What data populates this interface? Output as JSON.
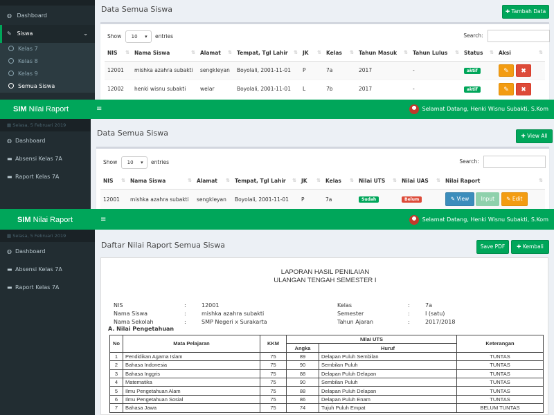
{
  "screen1": {
    "sidebar": {
      "items": [
        {
          "icon": "dashboard-icon",
          "label": "Dashboard"
        },
        {
          "icon": "edit-icon",
          "label": "Siswa"
        }
      ],
      "subitems": [
        "Kelas 7",
        "Kelas 8",
        "Kelas 9",
        "Semua Siswa"
      ]
    },
    "page_title": "Data Semua Siswa",
    "add_button": "Tambah Data",
    "show_label": "Show",
    "entries_value": "10",
    "entries_label": "entries",
    "search_label": "Search:",
    "columns": [
      "NIS",
      "Nama Siswa",
      "Alamat",
      "Tempat, Tgl Lahir",
      "JK",
      "Kelas",
      "Tahun Masuk",
      "Tahun Lulus",
      "Status",
      "Aksi"
    ],
    "rows": [
      {
        "nis": "12001",
        "nama": "mishka azahra subakti",
        "alamat": "sengkleyan",
        "ttl": "Boyolali, 2001-11-01",
        "jk": "P",
        "kelas": "7a",
        "masuk": "2017",
        "lulus": "-",
        "status": "aktif"
      },
      {
        "nis": "12002",
        "nama": "henki wisnu subakti",
        "alamat": "welar",
        "ttl": "Boyolali, 2001-11-01",
        "jk": "L",
        "kelas": "7b",
        "masuk": "2017",
        "lulus": "-",
        "status": "aktif"
      }
    ]
  },
  "screen2": {
    "brand_bold": "SIM",
    "brand_rest": " Nilai Raport",
    "welcome": "Selamat Datang, Henki Wisnu Subakti, S.Kom",
    "date": "Selasa, 5 Februari 2019",
    "sidebar": [
      "Dashboard",
      "Absensi Kelas 7A",
      "Raport Kelas 7A"
    ],
    "page_title": "Data Semua Siswa",
    "view_all_button": "View All",
    "show_label": "Show",
    "entries_value": "10",
    "entries_label": "entries",
    "search_label": "Search:",
    "columns": [
      "NIS",
      "Nama Siswa",
      "Alamat",
      "Tempat, Tgl Lahir",
      "JK",
      "Kelas",
      "Nilai UTS",
      "Nilai UAS",
      "Nilai Raport"
    ],
    "row": {
      "nis": "12001",
      "nama": "mishka azahra subakti",
      "alamat": "sengkleyan",
      "ttl": "Boyolali, 2001-11-01",
      "jk": "P",
      "kelas": "7a",
      "uts": "Sudah",
      "uas": "Belum"
    },
    "view_button": "View",
    "input_button": "Input",
    "edit_button": "Edit"
  },
  "screen3": {
    "brand_bold": "SIM",
    "brand_rest": " Nilai Raport",
    "welcome": "Selamat Datang, Henki Wisnu Subakti, S.Kom",
    "date": "Selasa, 5 Februari 2019",
    "sidebar": [
      "Dashboard",
      "Absensi Kelas 7A",
      "Raport Kelas 7A"
    ],
    "page_title": "Daftar Nilai Raport Semua Siswa",
    "save_pdf_button": "Save PDF",
    "back_button": "Kembali",
    "report_title1": "LAPORAN HASIL PENILAIAN",
    "report_title2": "ULANGAN TENGAH SEMESTER I",
    "info_left": [
      {
        "label": "NIS",
        "value": "12001"
      },
      {
        "label": "Nama Siswa",
        "value": "mishka azahra subakti"
      },
      {
        "label": "Nama Sekolah",
        "value": "SMP Negeri x Surakarta"
      }
    ],
    "info_right": [
      {
        "label": "Kelas",
        "value": "7a"
      },
      {
        "label": "Semester",
        "value": "I (satu)"
      },
      {
        "label": "Tahun Ajaran",
        "value": "2017/2018"
      }
    ],
    "colon": ":",
    "section_a": "A. Nilai Pengetahuan",
    "table_headers": {
      "no": "No",
      "mapel": "Mata Pelajaran",
      "kkm": "KKM",
      "nilai_uts": "Nilai UTS",
      "angka": "Angka",
      "huruf": "Huruf",
      "ket": "Keterangan"
    },
    "grades": [
      {
        "no": "1",
        "mapel": "Pendidikan Agama Islam",
        "kkm": "75",
        "angka": "89",
        "huruf": "Delapan Puluh Sembilan",
        "ket": "TUNTAS"
      },
      {
        "no": "2",
        "mapel": "Bahasa Indonesia",
        "kkm": "75",
        "angka": "90",
        "huruf": "Sembilan Puluh",
        "ket": "TUNTAS"
      },
      {
        "no": "3",
        "mapel": "Bahasa Inggris",
        "kkm": "75",
        "angka": "88",
        "huruf": "Delapan Puluh Delapan",
        "ket": "TUNTAS"
      },
      {
        "no": "4",
        "mapel": "Matematika",
        "kkm": "75",
        "angka": "90",
        "huruf": "Sembilan Puluh",
        "ket": "TUNTAS"
      },
      {
        "no": "5",
        "mapel": "Ilmu Pengetahuan Alam",
        "kkm": "75",
        "angka": "88",
        "huruf": "Delapan Puluh Delapan",
        "ket": "TUNTAS"
      },
      {
        "no": "6",
        "mapel": "Ilmu Pengetahuan Sosial",
        "kkm": "75",
        "angka": "86",
        "huruf": "Delapan Puluh Enam",
        "ket": "TUNTAS"
      },
      {
        "no": "7",
        "mapel": "Bahasa Jawa",
        "kkm": "75",
        "angka": "74",
        "huruf": "Tujuh Puluh Empat",
        "ket": "BELUM TUNTAS"
      }
    ]
  },
  "colors": {
    "green": "#00a65a",
    "sidebar": "#222d32",
    "blue": "#3c8dbc",
    "orange": "#f39c12",
    "red": "#dd4b39"
  }
}
